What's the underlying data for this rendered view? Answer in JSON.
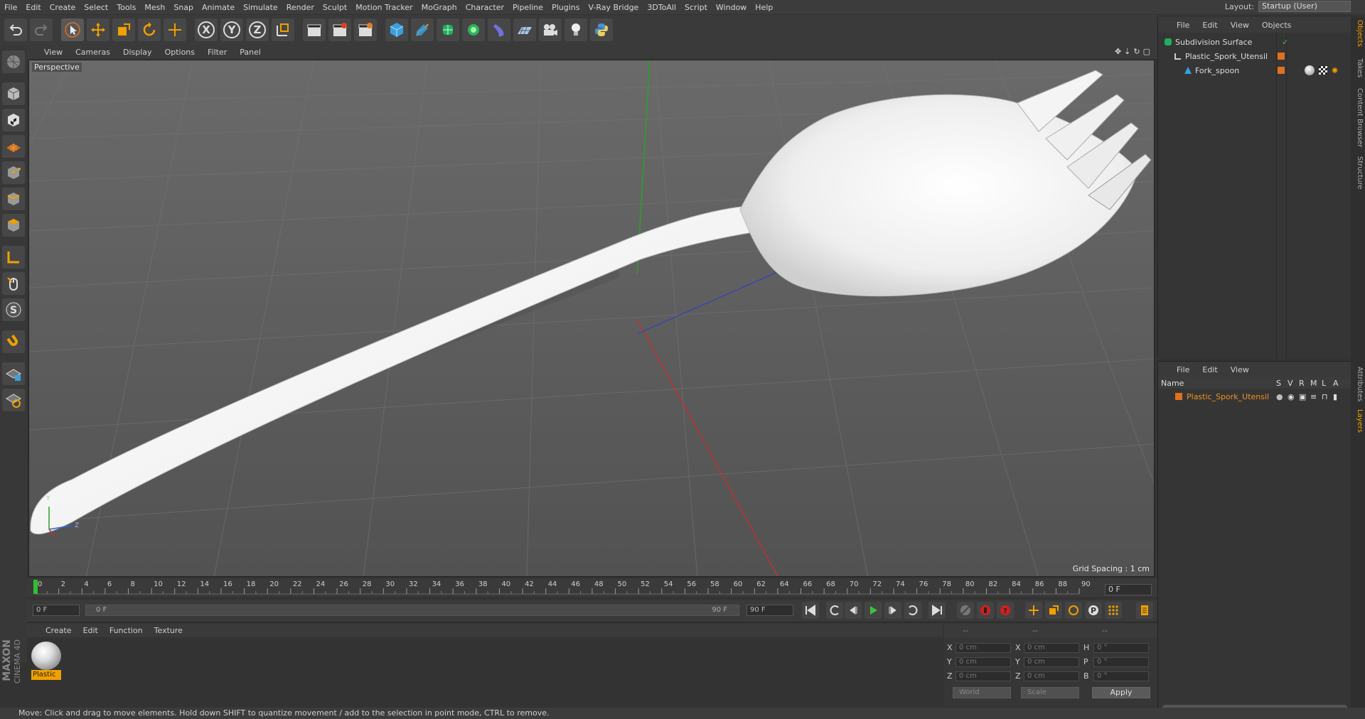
{
  "menubar": {
    "items": [
      "File",
      "Edit",
      "Create",
      "Select",
      "Tools",
      "Mesh",
      "Snap",
      "Animate",
      "Simulate",
      "Render",
      "Sculpt",
      "Motion Tracker",
      "MoGraph",
      "Character",
      "Pipeline",
      "Plugins",
      "V-Ray Bridge",
      "3DToAll",
      "Script",
      "Window",
      "Help"
    ],
    "layout_label": "Layout:",
    "layout_value": "Startup (User)"
  },
  "toolbar": {
    "axis_x": "X",
    "axis_y": "Y",
    "axis_z": "Z"
  },
  "viewport": {
    "menu": [
      "View",
      "Cameras",
      "Display",
      "Options",
      "Filter",
      "Panel"
    ],
    "camera_label": "Perspective",
    "grid_spacing": "Grid Spacing : 1 cm",
    "axis_y": "Y",
    "axis_z": "Z"
  },
  "timeline": {
    "ticks": [
      "0",
      "2",
      "4",
      "6",
      "8",
      "10",
      "12",
      "14",
      "16",
      "18",
      "20",
      "22",
      "24",
      "26",
      "28",
      "30",
      "32",
      "34",
      "36",
      "38",
      "40",
      "42",
      "44",
      "46",
      "48",
      "50",
      "52",
      "54",
      "56",
      "58",
      "60",
      "62",
      "64",
      "66",
      "68",
      "70",
      "72",
      "74",
      "76",
      "78",
      "80",
      "82",
      "84",
      "86",
      "88",
      "90"
    ],
    "current_frame": "0 F",
    "start_field": "0 F",
    "range_start": "0 F",
    "range_end": "90 F",
    "end_field": "90 F"
  },
  "materials": {
    "menu": [
      "Create",
      "Edit",
      "Function",
      "Texture"
    ],
    "items": [
      {
        "name": "Plastic"
      }
    ]
  },
  "coordinates": {
    "header": [
      "--",
      "--",
      "--"
    ],
    "rows": [
      {
        "a": "X",
        "av": "0 cm",
        "b": "X",
        "bv": "0 cm",
        "c": "H",
        "cv": "0 °"
      },
      {
        "a": "Y",
        "av": "0 cm",
        "b": "Y",
        "bv": "0 cm",
        "c": "P",
        "cv": "0 °"
      },
      {
        "a": "Z",
        "av": "0 cm",
        "b": "Z",
        "bv": "0 cm",
        "c": "B",
        "cv": "0 °"
      }
    ],
    "mode": "World",
    "scale": "Scale",
    "apply_label": "Apply"
  },
  "object_manager": {
    "menu": [
      "File",
      "Edit",
      "View",
      "Objects"
    ],
    "objects": [
      {
        "name": "Subdivision Surface",
        "depth": 0
      },
      {
        "name": "Plastic_Spork_Utensil",
        "depth": 1
      },
      {
        "name": "Fork_spoon",
        "depth": 2
      }
    ]
  },
  "layer_manager": {
    "menu": [
      "File",
      "Edit",
      "View"
    ],
    "columns": [
      "Name",
      "S",
      "V",
      "R",
      "M",
      "L",
      "A"
    ],
    "layers": [
      {
        "name": "Plastic_Spork_Utensil",
        "color": "#e07020"
      }
    ]
  },
  "side_tabs": {
    "top": [
      "Objects",
      "Takes",
      "Content Browser",
      "Structure"
    ],
    "bottom": [
      "Attributes",
      "Layers"
    ]
  },
  "logo": {
    "brand": "MAXON",
    "product": "CINEMA 4D"
  },
  "status": "Move: Click and drag to move elements. Hold down SHIFT to quantize movement / add to the selection in point mode, CTRL to remove."
}
